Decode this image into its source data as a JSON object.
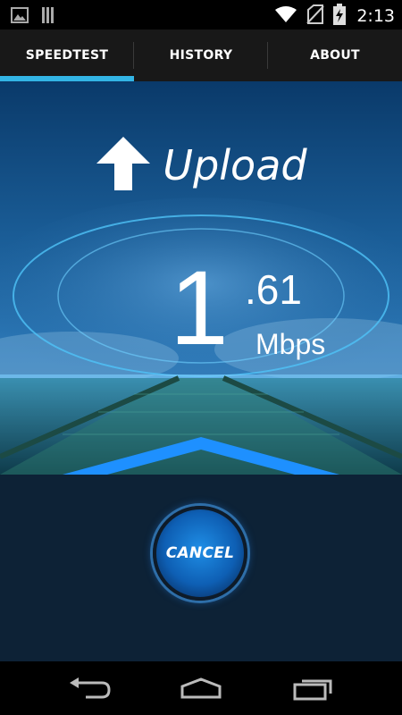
{
  "status_bar": {
    "time": "2:13"
  },
  "tabs": [
    {
      "label": "SPEEDTEST",
      "active": true
    },
    {
      "label": "HISTORY",
      "active": false
    },
    {
      "label": "ABOUT",
      "active": false
    }
  ],
  "test": {
    "direction": "Upload",
    "speed_integer": "1",
    "speed_fraction": ".61",
    "unit": "Mbps"
  },
  "cancel_button": {
    "label": "CANCEL"
  },
  "colors": {
    "accent": "#33b5e5",
    "panel": "#0d2236",
    "button": "#1f8ee6"
  },
  "icons": [
    "gallery-icon",
    "sdcard-icon",
    "wifi-icon",
    "no-sim-icon",
    "battery-charging-icon",
    "upload-arrow-icon",
    "back-icon",
    "home-icon",
    "recents-icon"
  ]
}
